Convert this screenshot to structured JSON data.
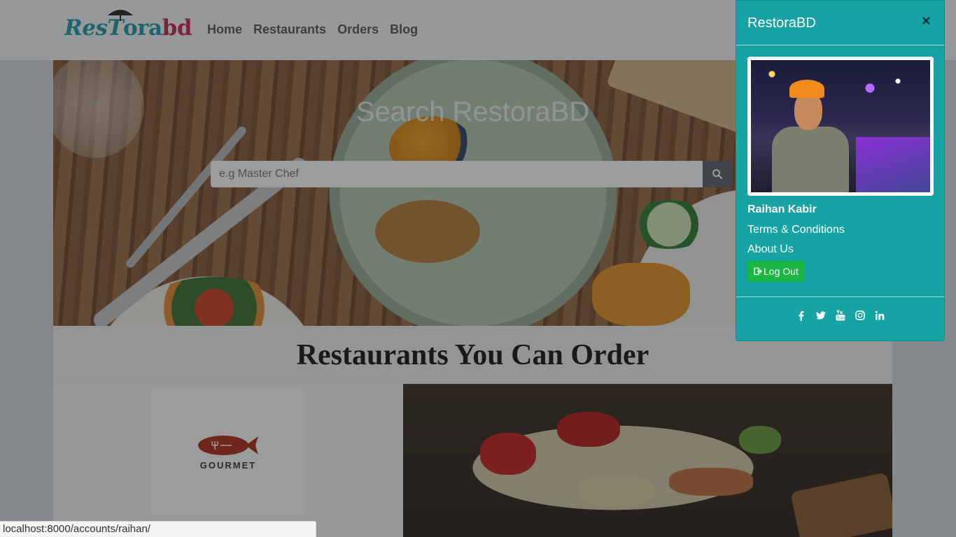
{
  "navbar": {
    "logo_part1": "Res",
    "logo_part2": "T",
    "logo_part3": "ora",
    "logo_part4": "bd",
    "links": [
      "Home",
      "Restaurants",
      "Orders",
      "Blog"
    ]
  },
  "hero": {
    "title": "Search RestoraBD",
    "search_placeholder": "e.g Master Chef",
    "search_icon": "search-icon"
  },
  "section": {
    "title": "Restaurants You Can Order"
  },
  "card": {
    "brand": "GOURMET"
  },
  "sidebar": {
    "title": "RestoraBD",
    "close_label": "×",
    "user_name": "Raihan Kabir",
    "links": [
      "Terms & Conditions",
      "About Us"
    ],
    "logout_label": "Log Out",
    "socials": [
      "facebook-icon",
      "twitter-icon",
      "youtube-icon",
      "instagram-icon",
      "linkedin-icon"
    ]
  },
  "status": {
    "url": "localhost:8000/accounts/raihan/"
  },
  "colors": {
    "panel": "#17a2a3",
    "logout": "#1ab744",
    "logo_teal": "#1f9aa0",
    "logo_red": "#c2254d"
  }
}
